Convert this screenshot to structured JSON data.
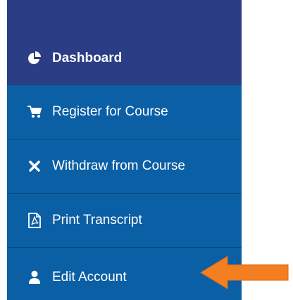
{
  "sidebar": {
    "items": [
      {
        "label": "Dashboard",
        "icon": "pie-chart-icon",
        "active": true
      },
      {
        "label": "Register for Course",
        "icon": "shopping-cart-icon",
        "active": false
      },
      {
        "label": "Withdraw from Course",
        "icon": "x-mark-icon",
        "active": false
      },
      {
        "label": "Print Transcript",
        "icon": "pdf-file-icon",
        "active": false
      },
      {
        "label": "Edit Account",
        "icon": "user-icon",
        "active": false
      }
    ]
  },
  "annotation": {
    "pointer": "orange-arrow-icon",
    "color": "#f47f20"
  },
  "colors": {
    "sidebar_bg": "#0b5fa5",
    "active_bg": "#2b3d84",
    "text": "#ffffff"
  }
}
